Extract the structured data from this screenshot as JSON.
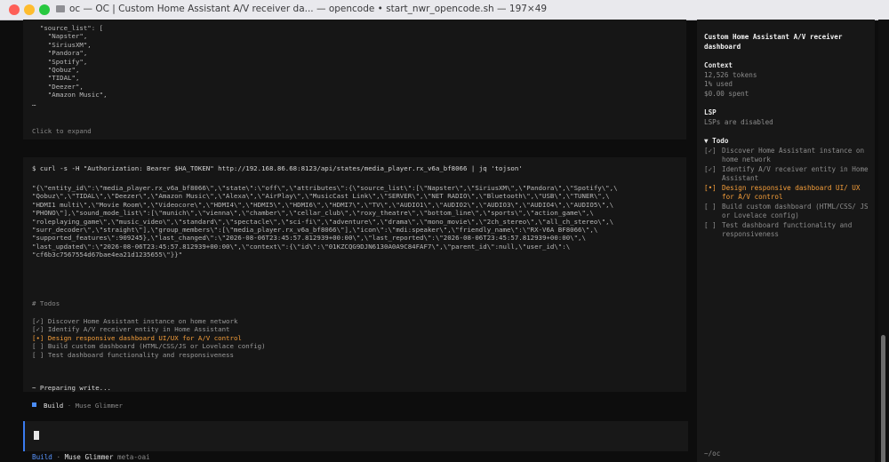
{
  "window": {
    "title": "oc — OC | Custom Home Assistant A/V receiver da... — opencode • start_nwr_opencode.sh — 197×49"
  },
  "output_top": {
    "lines": [
      "  \"source_list\": [",
      "    \"Napster\",",
      "    \"SiriusXM\",",
      "    \"Pandora\",",
      "    \"Spotify\",",
      "    \"Qobuz\",",
      "    \"TIDAL\",",
      "    \"Deezer\",",
      "    \"Amazon Music\",",
      "…"
    ],
    "expand_hint": "Click to expand"
  },
  "command": {
    "line": "$ curl -s -H \"Authorization: Bearer $HA_TOKEN\" http://192.168.86.68:8123/api/states/media_player.rx_v6a_bf8066 | jq 'tojson'",
    "output_lines": [
      "\"{\\\"entity_id\\\":\\\"media_player.rx_v6a_bf8066\\\",\\\"state\\\":\\\"off\\\",\\\"attributes\\\":{\\\"source_list\\\":[\\\"Napster\\\",\\\"SiriusXM\\\",\\\"Pandora\\\",\\\"Spotify\\\",\\",
      "\"Qobuz\\\",\\\"TIDAL\\\",\\\"Deezer\\\",\\\"Amazon Music\\\",\\\"Alexa\\\",\\\"AirPlay\\\",\\\"MusicCast Link\\\",\\\"SERVER\\\",\\\"NET RADIO\\\",\\\"Bluetooth\\\",\\\"USB\\\",\\\"TUNER\\\",\\",
      "\"HDMI1 multi\\\",\\\"Movie Room\\\",\\\"Videocore\\\",\\\"HDMI4\\\",\\\"HDMI5\\\",\\\"HDMI6\\\",\\\"HDMI7\\\",\\\"TV\\\",\\\"AUDIO1\\\",\\\"AUDIO2\\\",\\\"AUDIO3\\\",\\\"AUDIO4\\\",\\\"AUDIO5\\\",\\",
      "\"PHONO\\\"],\\\"sound_mode_list\\\":[\\\"munich\\\",\\\"vienna\\\",\\\"chamber\\\",\\\"cellar_club\\\",\\\"roxy_theatre\\\",\\\"bottom_line\\\",\\\"sports\\\",\\\"action_game\\\",\\",
      "\"roleplaying_game\\\",\\\"music_video\\\",\\\"standard\\\",\\\"spectacle\\\",\\\"sci-fi\\\",\\\"adventure\\\",\\\"drama\\\",\\\"mono_movie\\\",\\\"2ch_stereo\\\",\\\"all_ch_stereo\\\",\\",
      "\"surr_decoder\\\",\\\"straight\\\"],\\\"group_members\\\":[\\\"media_player.rx_v6a_bf8066\\\"],\\\"icon\\\":\\\"mdi:speaker\\\",\\\"friendly_name\\\":\\\"RX-V6A BF8066\\\",\\",
      "\"supported_features\\\":909245},\\\"last_changed\\\":\\\"2026-08-06T23:45:57.812939+00:00\\\",\\\"last_reported\\\":\\\"2026-08-06T23:45:57.812939+00:00\\\",\\",
      "\"last_updated\\\":\\\"2026-08-06T23:45:57.812939+00:00\\\",\\\"context\\\":{\\\"id\\\":\\\"01KZCQG9DJN6130A0A9C84FAF7\\\",\\\"parent_id\\\":null,\\\"user_id\\\":\\",
      "\"cf6b3c7567554d67bae4ea21d1235655\\\"}}\""
    ]
  },
  "todos": {
    "header": "# Todos",
    "items": [
      {
        "mark": "[✓]",
        "text": "Discover Home Assistant instance on home network",
        "status": "done"
      },
      {
        "mark": "[✓]",
        "text": "Identify A/V receiver entity in Home Assistant",
        "status": "done"
      },
      {
        "mark": "[•]",
        "text": "Design responsive dashboard UI/UX for A/V control",
        "status": "active"
      },
      {
        "mark": "[ ]",
        "text": "Build custom dashboard (HTML/CSS/JS or Lovelace config)",
        "status": "pending"
      },
      {
        "mark": "[ ]",
        "text": "Test dashboard functionality and responsiveness",
        "status": "pending"
      }
    ]
  },
  "status": {
    "preparing": "~ Preparing write...",
    "agent": "Build",
    "separator": "·",
    "model": "Muse Glimmer"
  },
  "footer": {
    "agent": "Build",
    "separator": "·",
    "model": "Muse Glimmer",
    "provider": "meta-oai"
  },
  "sidebar": {
    "title": "Custom Home Assistant A/V receiver dashboard",
    "context": {
      "header": "Context",
      "tokens": "12,526 tokens",
      "used": "1% used",
      "spent": "$0.00 spent"
    },
    "lsp": {
      "header": "LSP",
      "status": "LSPs are disabled"
    },
    "todo": {
      "header": "▼ Todo",
      "items": [
        {
          "mark": "[✓]",
          "text": "Discover Home Assistant instance on home network",
          "status": "done"
        },
        {
          "mark": "[✓]",
          "text": "Identify A/V receiver entity in Home Assistant",
          "status": "done"
        },
        {
          "mark": "[•]",
          "text": "Design responsive dashboard UI/ UX for A/V control",
          "status": "active"
        },
        {
          "mark": "[ ]",
          "text": "Build custom dashboard (HTML/CSS/ JS or Lovelace config)",
          "status": "pending"
        },
        {
          "mark": "[ ]",
          "text": "Test dashboard functionality and responsiveness",
          "status": "pending"
        }
      ]
    },
    "cwd": "~/oc"
  },
  "colors": {
    "accent": "#5a96ff",
    "active_todo": "#f59e3a",
    "background": "#0d0d0d",
    "panel": "#161616"
  }
}
